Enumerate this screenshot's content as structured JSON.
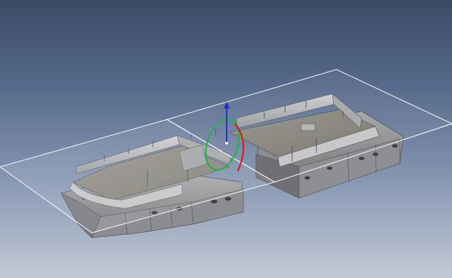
{
  "viewport": {
    "background_top": "#3b4a66",
    "background_bottom": "#c3c9d6"
  },
  "model": {
    "hull_color": "#8f9092",
    "deck_color": "#8b8a82",
    "hull_shadow_color": "#5f6063",
    "hull_light_color": "#b9babb"
  },
  "section_plane": {
    "edge_color": "#ffffff"
  },
  "manipulator": {
    "axes": [
      {
        "name": "z-axis",
        "color": "#1f2fd6"
      },
      {
        "name": "x-rotation-ring",
        "color": "#d21f1f"
      },
      {
        "name": "y-rotation-ring",
        "color": "#1fb34a"
      }
    ]
  }
}
